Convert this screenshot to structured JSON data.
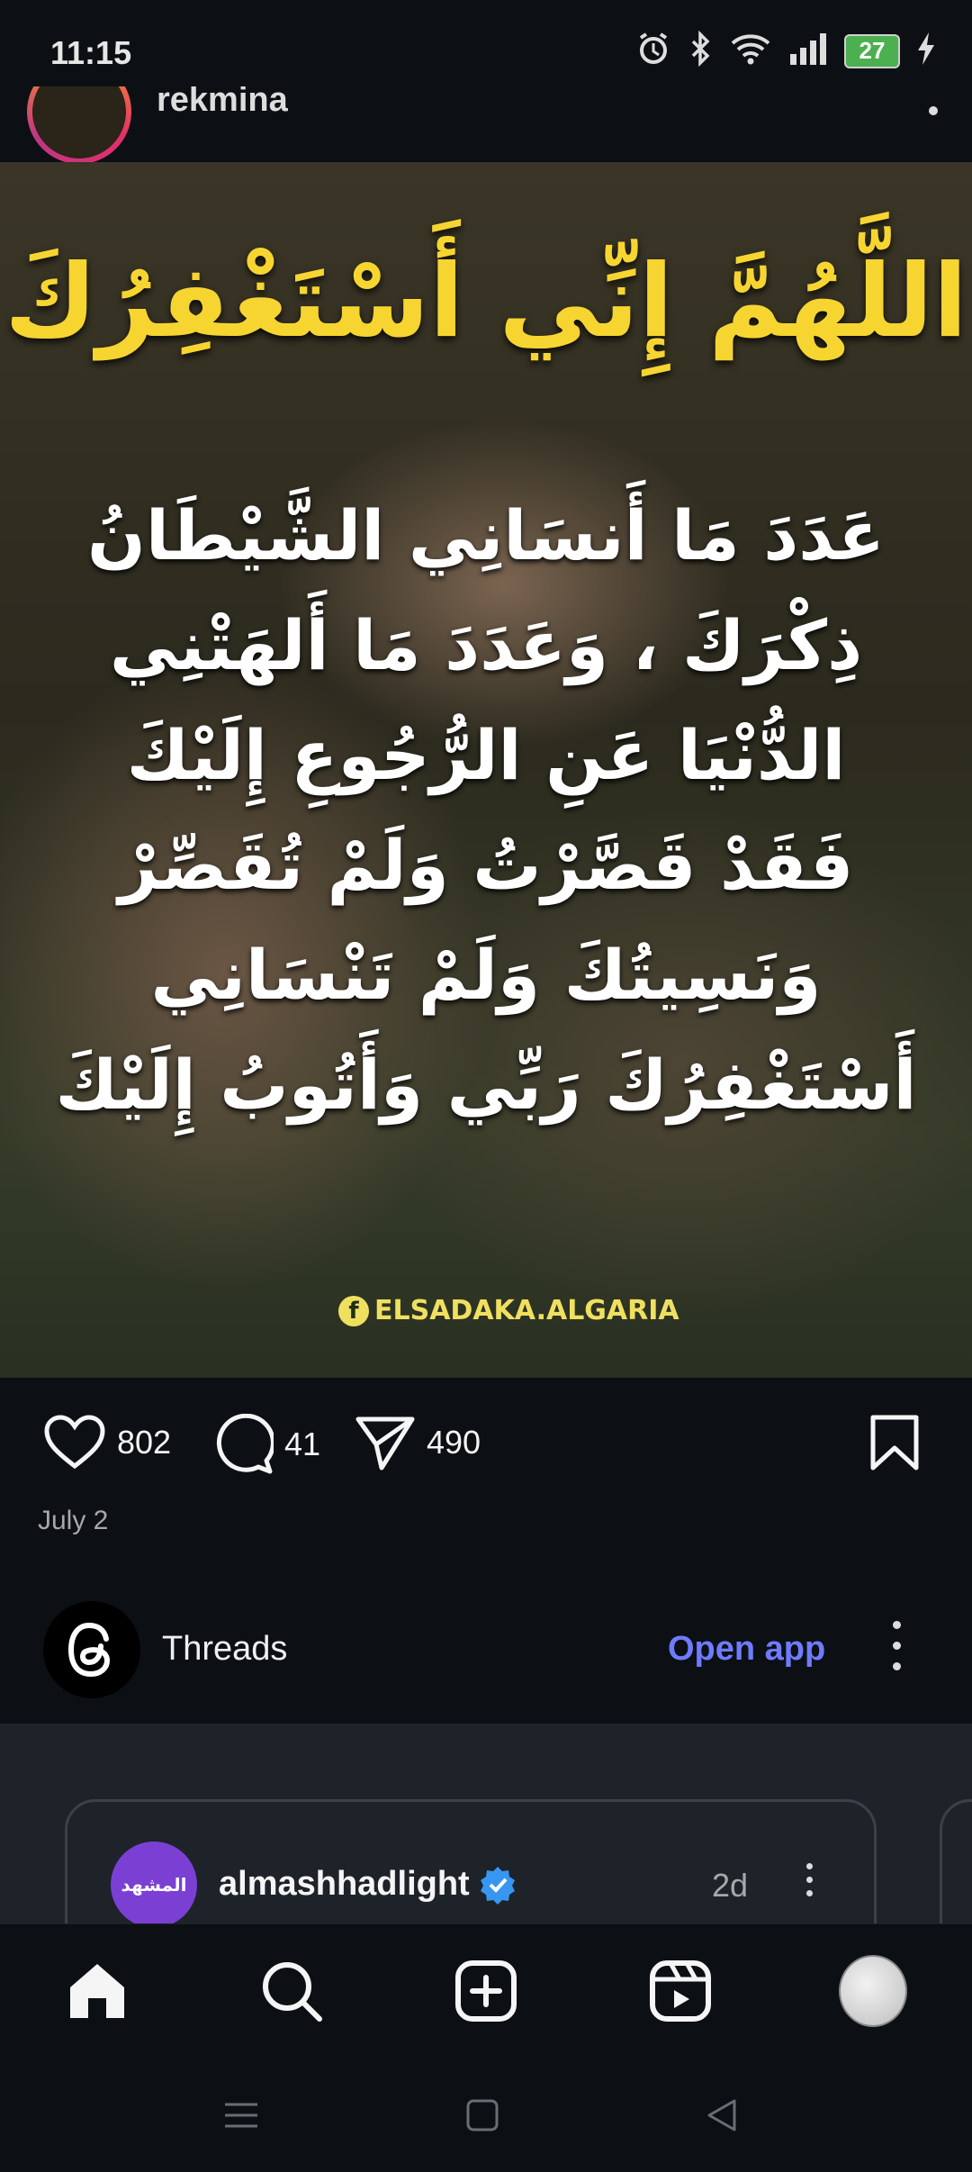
{
  "status_bar": {
    "time": "11:15",
    "battery": "27",
    "icons": [
      "alarm-icon",
      "bluetooth-icon",
      "wifi-icon",
      "signal-icon",
      "battery-icon",
      "charging-icon"
    ]
  },
  "post": {
    "username": "rekmina",
    "image_text": {
      "title": "اللَّهُمَّ إِنِّي أَسْتَغْفِرُكَ",
      "lines": [
        "عَدَدَ مَا أَنسَانِي الشَّيْطَانُ",
        "ذِكْرَكَ ، وَعَدَدَ مَا أَلهَتْنِي",
        "الدُّنْيَا عَنِ الرُّجُوعِ إِلَيْكَ",
        "فَقَدْ قَصَّرْتُ وَلَمْ تُقَصِّرْ",
        "وَنَسِيتُكَ وَلَمْ تَنْسَانِي",
        "أَسْتَغْفِرُكَ رَبِّي وَأَتُوبُ إِلَيْكَ"
      ],
      "watermark": "ELSADAKA.ALGARIA"
    },
    "likes": "802",
    "comments": "41",
    "shares": "490",
    "date": "July 2"
  },
  "threads_banner": {
    "label": "Threads",
    "open_app": "Open app"
  },
  "suggested_card": {
    "avatar_text": "المشهد",
    "name": "almashhadlight",
    "time": "2d"
  },
  "colors": {
    "background": "#0c1014",
    "accent_link": "#6f7bff",
    "title_yellow": "#f7d531",
    "verified": "#3797f0",
    "battery_green": "#4caf50"
  }
}
